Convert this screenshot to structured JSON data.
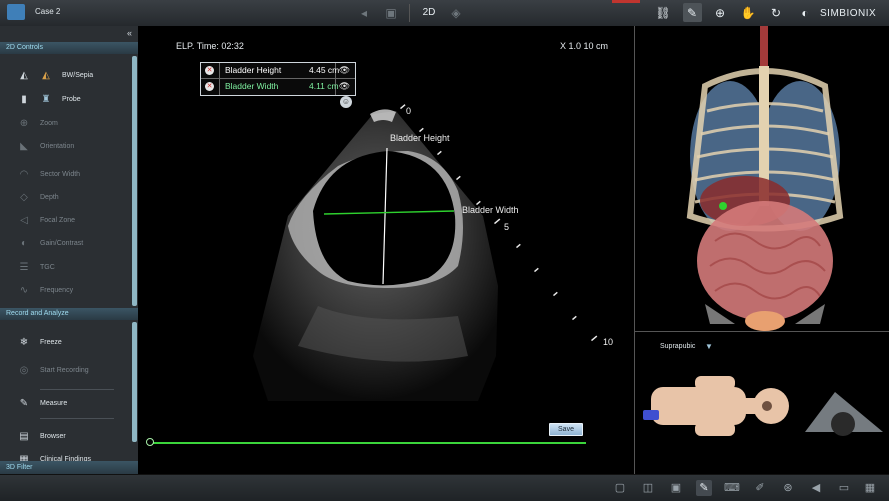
{
  "topbar": {
    "case_label": "Case 2",
    "mode_label": "2D",
    "brand": "SIMBIONIX",
    "icons": [
      "link-icon",
      "probe-icon",
      "zoom-icon",
      "hand-icon",
      "rotate-icon",
      "light-icon"
    ]
  },
  "controls_2d": {
    "header": "2D Controls",
    "collapse": "«",
    "items": [
      {
        "label": "BW/Sepia",
        "icon": "bw-sepia-icon",
        "enabled": true
      },
      {
        "label": "Probe",
        "icon": "probe-icon",
        "enabled": true
      },
      {
        "label": "Zoom",
        "icon": "zoom-icon",
        "enabled": false
      },
      {
        "label": "Orientation",
        "icon": "orientation-icon",
        "enabled": false
      },
      {
        "label": "Sector Width",
        "icon": "sector-width-icon",
        "enabled": false
      },
      {
        "label": "Depth",
        "icon": "depth-icon",
        "enabled": false
      },
      {
        "label": "Focal Zone",
        "icon": "focal-zone-icon",
        "enabled": false
      },
      {
        "label": "Gain/Contrast",
        "icon": "gain-icon",
        "enabled": false
      },
      {
        "label": "TGC",
        "icon": "tgc-icon",
        "enabled": false
      },
      {
        "label": "Frequency",
        "icon": "frequency-icon",
        "enabled": false
      }
    ]
  },
  "record_analyze": {
    "header": "Record and Analyze",
    "items": [
      {
        "label": "Freeze",
        "icon": "snowflake-icon",
        "enabled": true
      },
      {
        "label": "Start Recording",
        "icon": "record-icon",
        "enabled": false
      },
      {
        "label": "Measure",
        "icon": "measure-icon",
        "enabled": true
      },
      {
        "label": "Browser",
        "icon": "browser-icon",
        "enabled": true
      },
      {
        "label": "Clinical Findings",
        "icon": "findings-icon",
        "enabled": true
      }
    ]
  },
  "filter_3d": {
    "header": "3D Filter"
  },
  "ultrasound": {
    "elp_time": "ELP. Time: 02:32",
    "scale": "X 1.0    10 cm",
    "measurements": [
      {
        "name": "Bladder Height",
        "value": "4.45 cm",
        "color": "#ffffff"
      },
      {
        "name": "Bladder Width",
        "value": "4.11 cm",
        "color": "#7ff0a0"
      }
    ],
    "labels": {
      "height": "Bladder Height",
      "width": "Bladder Width"
    },
    "depth_marks": [
      "0",
      "5",
      "10"
    ],
    "save_label": "Save"
  },
  "anatomy": {
    "view_label": "Suprapubic",
    "dropdown_arrow": "▼"
  },
  "colors": {
    "accent": "#9fdcf0",
    "timeline": "#3bd43b",
    "width_line": "#2ed12e"
  }
}
